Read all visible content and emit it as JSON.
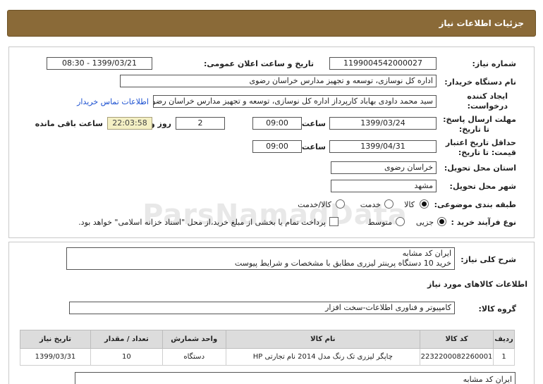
{
  "header": {
    "title": "جزئیات اطلاعات نیاز"
  },
  "need_number": {
    "label": "شماره نیاز:",
    "value": "1199004542000027"
  },
  "announce": {
    "label": "تاریخ و ساعت اعلان عمومی:",
    "value": "1399/03/21 - 08:30"
  },
  "buyer_org": {
    "label": "نام دستگاه خریدار:",
    "value": "اداره کل نوسازی، توسعه و تجهیز مدارس خراسان رضوی"
  },
  "creator": {
    "label_line1": "ایجاد کننده",
    "label_line2": "درخواست:",
    "value": "سید محمد داودی بهاباد کارپرداز اداره کل نوسازی، توسعه و تجهیز مدارس خراسان رضوی",
    "contact_link": "اطلاعات تماس خریدار"
  },
  "send_deadline": {
    "label_line1": "مهلت ارسال پاسخ:",
    "label_line2": "تا تاریخ:",
    "date": "1399/03/24",
    "time_label": "ساعت",
    "time": "09:00",
    "days": "2",
    "days_label": "روز و",
    "remaining": "22:03:58",
    "remaining_label": "ساعت باقی مانده"
  },
  "price_validity": {
    "label_line1": "حداقل تاریخ اعتبار",
    "label_line2": "قیمت: تا تاریخ:",
    "date": "1399/04/31",
    "time_label": "ساعت",
    "time": "09:00"
  },
  "province": {
    "label": "استان محل تحویل:",
    "value": "خراسان رضوی"
  },
  "city": {
    "label": "شهر محل تحویل:",
    "value": "مشهد"
  },
  "category": {
    "label": "طبقه بندی موضوعی:",
    "options": [
      "کالا",
      "خدمت",
      "کالا/خدمت"
    ],
    "selected": "کالا"
  },
  "process": {
    "label": "نوع فرآیند خرید :",
    "options": [
      "جزیی",
      "متوسط"
    ],
    "selected": "جزیی",
    "checkbox_text": "پرداخت تمام یا بخشی از مبلغ خرید،از محل \"اسناد خزانه اسلامی\" خواهد بود."
  },
  "watermark": "ParsNamadData",
  "summary": {
    "label": "شرح کلی نیاز:",
    "line1": "ایران کد مشابه",
    "line2": "خرید 10 دستگاه پرینتر لیزری مطابق با مشخصات و شرایط پیوست"
  },
  "goods_info": {
    "title": "اطلاعات کالاهای مورد نیاز"
  },
  "goods_group": {
    "label": "گروه کالا:",
    "value": "کامپیوتر و فناوری اطلاعات-سخت افزار"
  },
  "table": {
    "headers": [
      "ردیف",
      "کد کالا",
      "نام کالا",
      "واحد شمارش",
      "تعداد / مقدار",
      "تاریخ نیاز"
    ],
    "rows": [
      [
        "1",
        "2232200082260001",
        "چاپگر لیزری تک رنگ مدل 2014 نام تجارتی HP",
        "دستگاه",
        "10",
        "1399/03/31"
      ]
    ]
  },
  "bottom_note": "ایران کد مشابه"
}
